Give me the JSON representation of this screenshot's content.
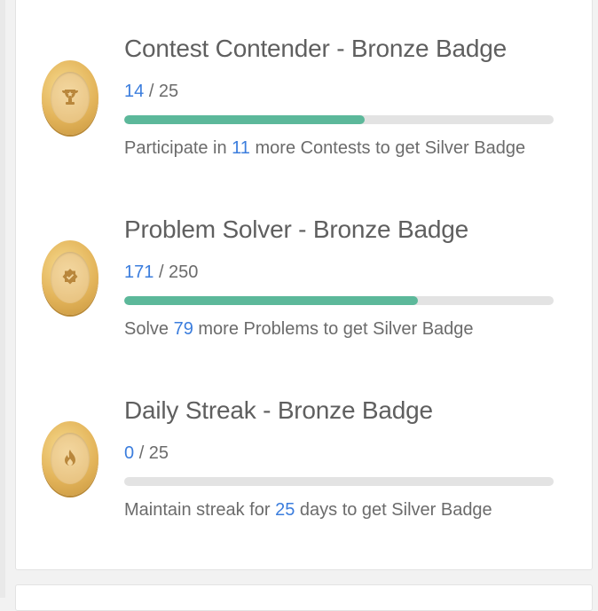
{
  "badges": [
    {
      "title": "Contest Contender - Bronze Badge",
      "current": "14",
      "total": "/ 25",
      "progress_fraction": 0.56,
      "hint_prefix": "Participate in ",
      "hint_number": "11",
      "hint_suffix": " more Contests to get Silver Badge",
      "icon": "trophy-icon"
    },
    {
      "title": "Problem Solver - Bronze Badge",
      "current": "171",
      "total": "/ 250",
      "progress_fraction": 0.684,
      "hint_prefix": "Solve ",
      "hint_number": "79",
      "hint_suffix": " more Problems to get Silver Badge",
      "icon": "puzzle-icon"
    },
    {
      "title": "Daily Streak - Bronze Badge",
      "current": "0",
      "total": "/ 25",
      "progress_fraction": 0,
      "hint_prefix": "Maintain streak for ",
      "hint_number": "25",
      "hint_suffix": " days to get Silver Badge",
      "icon": "flame-icon"
    }
  ],
  "colors": {
    "accent_number": "#3b7ddd",
    "progress_fill": "#5cb89a",
    "progress_track": "#e3e3e3",
    "medal_gold": "#e3b45a"
  }
}
